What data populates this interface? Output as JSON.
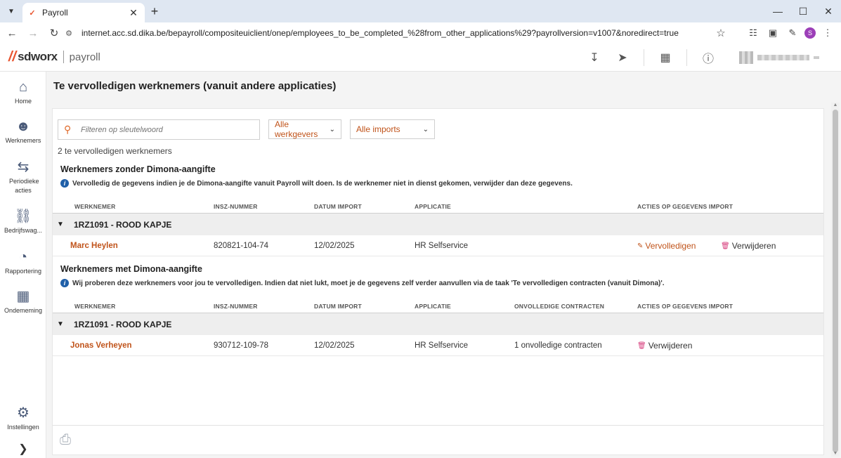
{
  "browser": {
    "tab_title": "Payroll",
    "url": "internet.acc.sd.dika.be/bepayroll/compositeuiclient/onep/employees_to_be_completed_%28from_other_applications%29?payrollversion=v1007&noredirect=true",
    "profile_initial": "S"
  },
  "header": {
    "brand": "sdworx",
    "product": "payroll"
  },
  "leftnav": {
    "items": [
      {
        "label": "Home",
        "icon": "home-icon"
      },
      {
        "label": "Werknemers",
        "icon": "people-icon"
      },
      {
        "label": "Periodieke acties",
        "icon": "repeat-icon"
      },
      {
        "label": "Bedrijfswag...",
        "icon": "car-icon"
      },
      {
        "label": "Rapportering",
        "icon": "pie-chart-icon"
      },
      {
        "label": "Ondememing",
        "icon": "building-icon"
      },
      {
        "label": "Instellingen",
        "icon": "gear-icon"
      }
    ]
  },
  "page": {
    "title": "Te vervolledigen werknemers (vanuit andere applicaties)",
    "search_placeholder": "Filteren op sleutelwoord",
    "filter_employers": "Alle werkgevers",
    "filter_imports": "Alle imports",
    "count_text": "2 te vervolledigen werknemers"
  },
  "columns": {
    "employee": "WERKNEMER",
    "insz": "INSZ-NUMMER",
    "import_date": "DATUM IMPORT",
    "application": "APPLICATIE",
    "incomplete_contracts": "ONVOLLEDIGE CONTRACTEN",
    "actions": "ACTIES OP GEGEVENS IMPORT"
  },
  "section1": {
    "title": "Werknemers zonder Dimona-aangifte",
    "info": "Vervolledig de gegevens indien je de Dimona-aangifte vanuit Payroll wilt doen. Is de werknemer niet in dienst gekomen, verwijder dan deze gegevens.",
    "group": "1RZ1091 - ROOD KAPJE",
    "rows": [
      {
        "name": "Marc Heylen",
        "insz": "820821-104-74",
        "date": "12/02/2025",
        "app": "HR Selfservice",
        "action_complete": "Vervolledigen",
        "action_delete": "Verwijderen"
      }
    ]
  },
  "section2": {
    "title": "Werknemers met Dimona-aangifte",
    "info": "Wij proberen deze werknemers voor jou te vervolledigen. Indien dat niet lukt, moet je de gegevens zelf verder aanvullen via de taak 'Te vervolledigen contracten (vanuit Dimona)'.",
    "group": "1RZ1091 - ROOD KAPJE",
    "rows": [
      {
        "name": "Jonas Verheyen",
        "insz": "930712-109-78",
        "date": "12/02/2025",
        "app": "HR Selfservice",
        "contracts": "1 onvolledige contracten",
        "action_delete": "Verwijderen"
      }
    ]
  }
}
